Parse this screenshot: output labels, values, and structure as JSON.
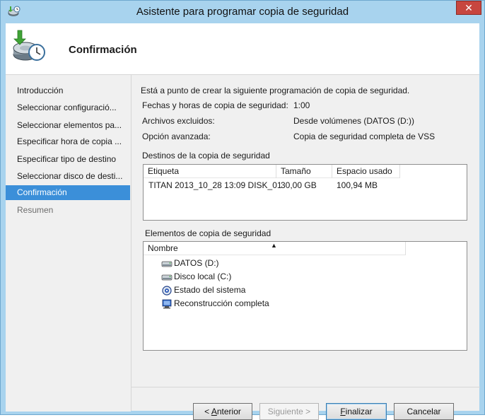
{
  "window": {
    "title": "Asistente para programar copia de seguridad",
    "close_label": "✕"
  },
  "header": {
    "title": "Confirmación",
    "icon": "backup-schedule-icon"
  },
  "sidebar": {
    "items": [
      {
        "label": "Introducción",
        "state": "normal"
      },
      {
        "label": "Seleccionar configuració...",
        "state": "normal"
      },
      {
        "label": "Seleccionar elementos pa...",
        "state": "normal"
      },
      {
        "label": "Especificar hora de copia ...",
        "state": "normal"
      },
      {
        "label": "Especificar tipo de destino",
        "state": "normal"
      },
      {
        "label": "Seleccionar disco de desti...",
        "state": "normal"
      },
      {
        "label": "Confirmación",
        "state": "active"
      },
      {
        "label": "Resumen",
        "state": "disabled"
      }
    ]
  },
  "main": {
    "intro": "Está a punto de crear la siguiente programación de copia de seguridad.",
    "fields": [
      {
        "label": "Fechas y horas de copia de seguridad:",
        "value": "1:00"
      },
      {
        "label": "Archivos excluidos:",
        "value": "Desde volúmenes (DATOS (D:))"
      },
      {
        "label": "Opción avanzada:",
        "value": "Copia de seguridad completa de VSS"
      }
    ],
    "destinations": {
      "title": "Destinos de la copia de seguridad",
      "columns": [
        "Etiqueta",
        "Tamaño",
        "Espacio usado"
      ],
      "rows": [
        [
          "TITAN 2013_10_28 13:09 DISK_01",
          "30,00 GB",
          "100,94 MB"
        ]
      ]
    },
    "items": {
      "title": "Elementos de copia de seguridad",
      "column": "Nombre",
      "sort_indicator": "▲",
      "rows": [
        {
          "label": "DATOS (D:)",
          "icon": "drive-icon"
        },
        {
          "label": "Disco local (C:)",
          "icon": "drive-icon"
        },
        {
          "label": "Estado del sistema",
          "icon": "system-state-icon"
        },
        {
          "label": "Reconstrucción completa",
          "icon": "bare-metal-recovery-icon"
        }
      ]
    }
  },
  "buttons": {
    "back_prefix": "< ",
    "back_accel": "A",
    "back_rest": "nterior",
    "next": "Siguiente >",
    "finish_accel": "F",
    "finish_rest": "inalizar",
    "cancel": "Cancelar"
  }
}
